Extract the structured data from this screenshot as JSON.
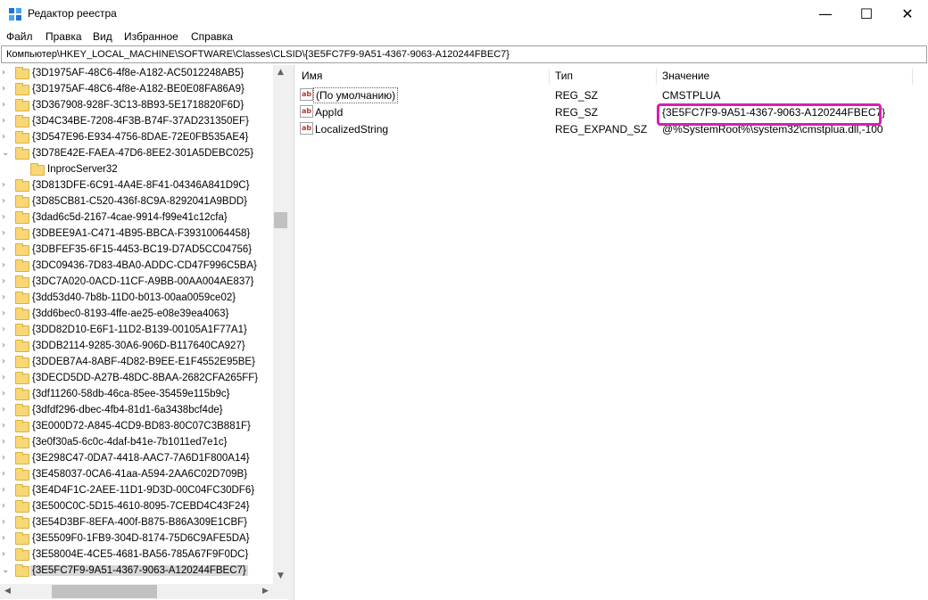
{
  "window": {
    "title": "Редактор реестра",
    "minimize_glyph": "—",
    "maximize_glyph": "☐",
    "close_glyph": "✕"
  },
  "menu": [
    "Файл",
    "Правка",
    "Вид",
    "Избранное",
    "Справка"
  ],
  "address": "Компьютер\\HKEY_LOCAL_MACHINE\\SOFTWARE\\Classes\\CLSID\\{3E5FC7F9-9A51-4367-9063-A120244FBEC7}",
  "tree": [
    {
      "label": "{3D1975AF-48C6-4f8e-A182-AC5012248AB5}",
      "arrow": "›"
    },
    {
      "label": "{3D1975AF-48C6-4f8e-A182-BE0E08FA86A9}",
      "arrow": "›"
    },
    {
      "label": "{3D367908-928F-3C13-8B93-5E1718820F6D}",
      "arrow": "›"
    },
    {
      "label": "{3D4C34BE-7208-4F3B-B74F-37AD231350EF}",
      "arrow": "›"
    },
    {
      "label": "{3D547E96-E934-4756-8DAE-72E0FB535AE4}",
      "arrow": "›"
    },
    {
      "label": "{3D78E42E-FAEA-47D6-8EE2-301A5DEBC025}",
      "arrow": "⌄"
    },
    {
      "label": "InprocServer32",
      "arrow": "",
      "child": true
    },
    {
      "label": "{3D813DFE-6C91-4A4E-8F41-04346A841D9C}",
      "arrow": "›"
    },
    {
      "label": "{3D85CB81-C520-436f-8C9A-8292041A9BDD}",
      "arrow": "›"
    },
    {
      "label": "{3dad6c5d-2167-4cae-9914-f99e41c12cfa}",
      "arrow": "›"
    },
    {
      "label": "{3DBEE9A1-C471-4B95-BBCA-F39310064458}",
      "arrow": "›"
    },
    {
      "label": "{3DBFEF35-6F15-4453-BC19-D7AD5CC04756}",
      "arrow": "›"
    },
    {
      "label": "{3DC09436-7D83-4BA0-ADDC-CD47F996C5BA}",
      "arrow": "›"
    },
    {
      "label": "{3DC7A020-0ACD-11CF-A9BB-00AA004AE837}",
      "arrow": "›"
    },
    {
      "label": "{3dd53d40-7b8b-11D0-b013-00aa0059ce02}",
      "arrow": "›"
    },
    {
      "label": "{3dd6bec0-8193-4ffe-ae25-e08e39ea4063}",
      "arrow": "›"
    },
    {
      "label": "{3DD82D10-E6F1-11D2-B139-00105A1F77A1}",
      "arrow": "›",
      "accent": true
    },
    {
      "label": "{3DDB2114-9285-30A6-906D-B117640CA927}",
      "arrow": "›"
    },
    {
      "label": "{3DDEB7A4-8ABF-4D82-B9EE-E1F4552E95BE}",
      "arrow": "›"
    },
    {
      "label": "{3DECD5DD-A27B-48DC-8BAA-2682CFA265FF}",
      "arrow": "›"
    },
    {
      "label": "{3df11260-58db-46ca-85ee-35459e115b9c}",
      "arrow": "›"
    },
    {
      "label": "{3dfdf296-dbec-4fb4-81d1-6a3438bcf4de}",
      "arrow": "›"
    },
    {
      "label": "{3E000D72-A845-4CD9-BD83-80C07C3B881F}",
      "arrow": "›"
    },
    {
      "label": "{3e0f30a5-6c0c-4daf-b41e-7b1011ed7e1c}",
      "arrow": "›"
    },
    {
      "label": "{3E298C47-0DA7-4418-AAC7-7A6D1F800A14}",
      "arrow": "›"
    },
    {
      "label": "{3E458037-0CA6-41aa-A594-2AA6C02D709B}",
      "arrow": "›"
    },
    {
      "label": "{3E4D4F1C-2AEE-11D1-9D3D-00C04FC30DF6}",
      "arrow": "›"
    },
    {
      "label": "{3E500C0C-5D15-4610-8095-7CEBD4C43F24}",
      "arrow": "›"
    },
    {
      "label": "{3E54D3BF-8EFA-400f-B875-B86A309E1CBF}",
      "arrow": "›"
    },
    {
      "label": "{3E5509F0-1FB9-304D-8174-75D6C9AFE5DA}",
      "arrow": "›"
    },
    {
      "label": "{3E58004E-4CE5-4681-BA56-785A67F9F0DC}",
      "arrow": "›"
    },
    {
      "label": "{3E5FC7F9-9A51-4367-9063-A120244FBEC7}",
      "arrow": "⌄",
      "selected": true
    }
  ],
  "columns": {
    "name": "Имя",
    "type": "Тип",
    "data": "Значение"
  },
  "values": [
    {
      "name": "(По умолчанию)",
      "type": "REG_SZ",
      "data": "CMSTPLUA",
      "icon": "ab",
      "boxed": true
    },
    {
      "name": "AppId",
      "type": "REG_SZ",
      "data": "{3E5FC7F9-9A51-4367-9063-A120244FBEC7}",
      "icon": "ab"
    },
    {
      "name": "LocalizedString",
      "type": "REG_EXPAND_SZ",
      "data": "@%SystemRoot%\\system32\\cmstplua.dll,-100",
      "icon": "ab"
    }
  ],
  "scroll_glyphs": {
    "up": "▲",
    "down": "▼",
    "left": "◀",
    "right": "▶"
  },
  "colors": {
    "highlight": "#d91eb5",
    "folder": "#f8d775",
    "selection": "#d9d9d9",
    "accent_arrow": "#3c9ce4"
  }
}
